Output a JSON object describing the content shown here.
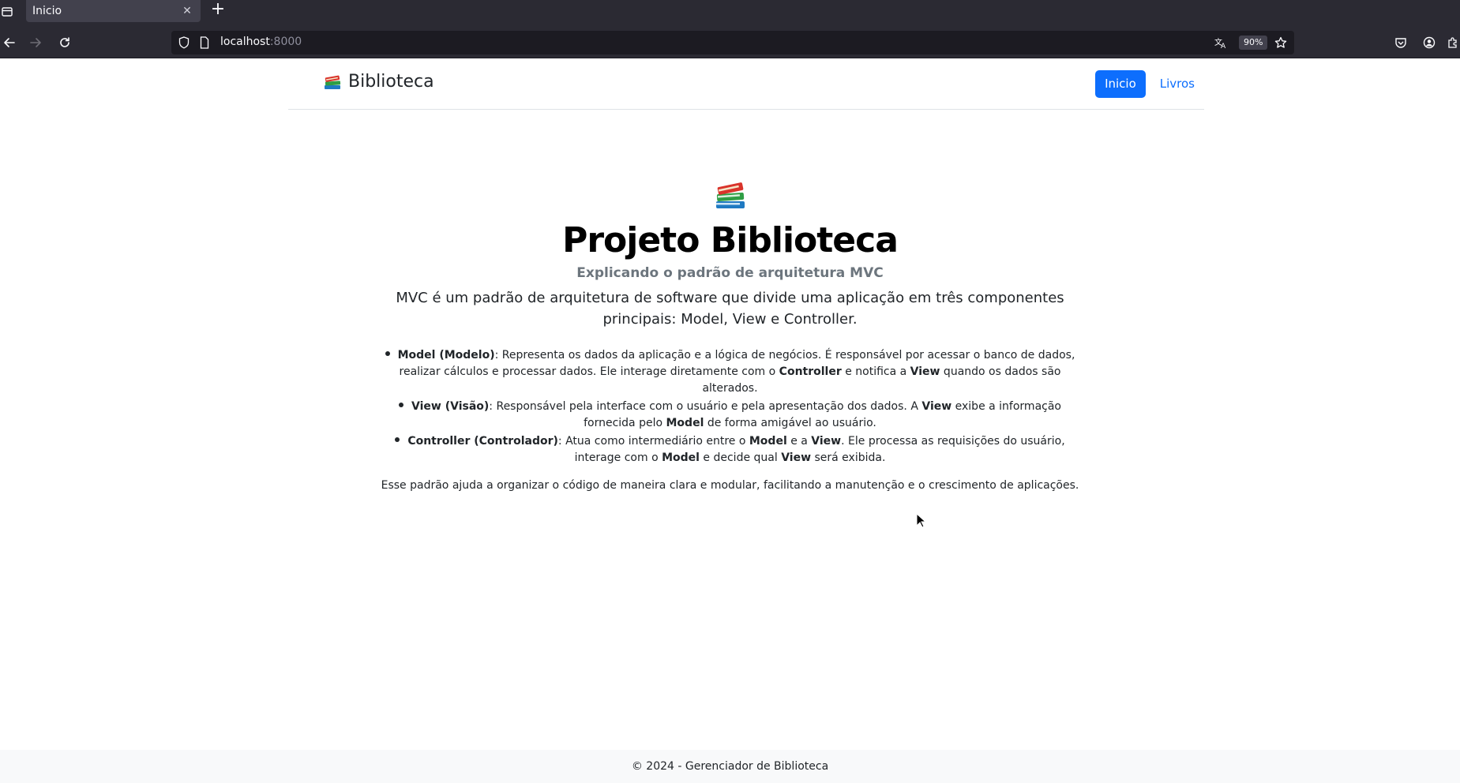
{
  "browser": {
    "tab_title": "Inicio",
    "url_host": "localhost",
    "url_port": ":8000",
    "zoom": "90%"
  },
  "header": {
    "brand": "Biblioteca",
    "nav": [
      {
        "label": "Inicio",
        "active": true
      },
      {
        "label": "Livros",
        "active": false
      }
    ]
  },
  "hero": {
    "title": "Projeto Biblioteca",
    "subtitle": "Explicando o padrão de arquitetura MVC",
    "lead": "MVC é um padrão de arquitetura de software que divide uma aplicação em três componentes principais: Model, View e Controller."
  },
  "mvc": {
    "model_term": "Model (Modelo)",
    "model_text_1": ": Representa os dados da aplicação e a lógica de negócios. É responsável por acessar o banco de dados, realizar cálculos e processar dados. Ele interage diretamente com o ",
    "model_ref_controller": "Controller",
    "model_text_2": " e notifica a ",
    "model_ref_view": "View",
    "model_text_3": " quando os dados são alterados.",
    "view_term": "View (Visão)",
    "view_text_1": ": Responsável pela interface com o usuário e pela apresentação dos dados. A ",
    "view_ref_view": "View",
    "view_text_2": " exibe a informação fornecida pelo ",
    "view_ref_model": "Model",
    "view_text_3": " de forma amigável ao usuário.",
    "controller_term": "Controller (Controlador)",
    "controller_text_1": ": Atua como intermediário entre o ",
    "controller_ref_model": "Model",
    "controller_text_2": " e a ",
    "controller_ref_view": "View",
    "controller_text_3": ". Ele processa as requisições do usuário, interage com o ",
    "controller_ref_model2": "Model",
    "controller_text_4": " e decide qual ",
    "controller_ref_view2": "View",
    "controller_text_5": " será exibida."
  },
  "closing": "Esse padrão ajuda a organizar o código de maneira clara e modular, facilitando a manutenção e o crescimento de aplicações.",
  "footer": "© 2024 - Gerenciador de Biblioteca",
  "colors": {
    "primary": "#0d6efd",
    "chrome": "#2b2a33",
    "footer_bg": "#f8f9fa"
  }
}
